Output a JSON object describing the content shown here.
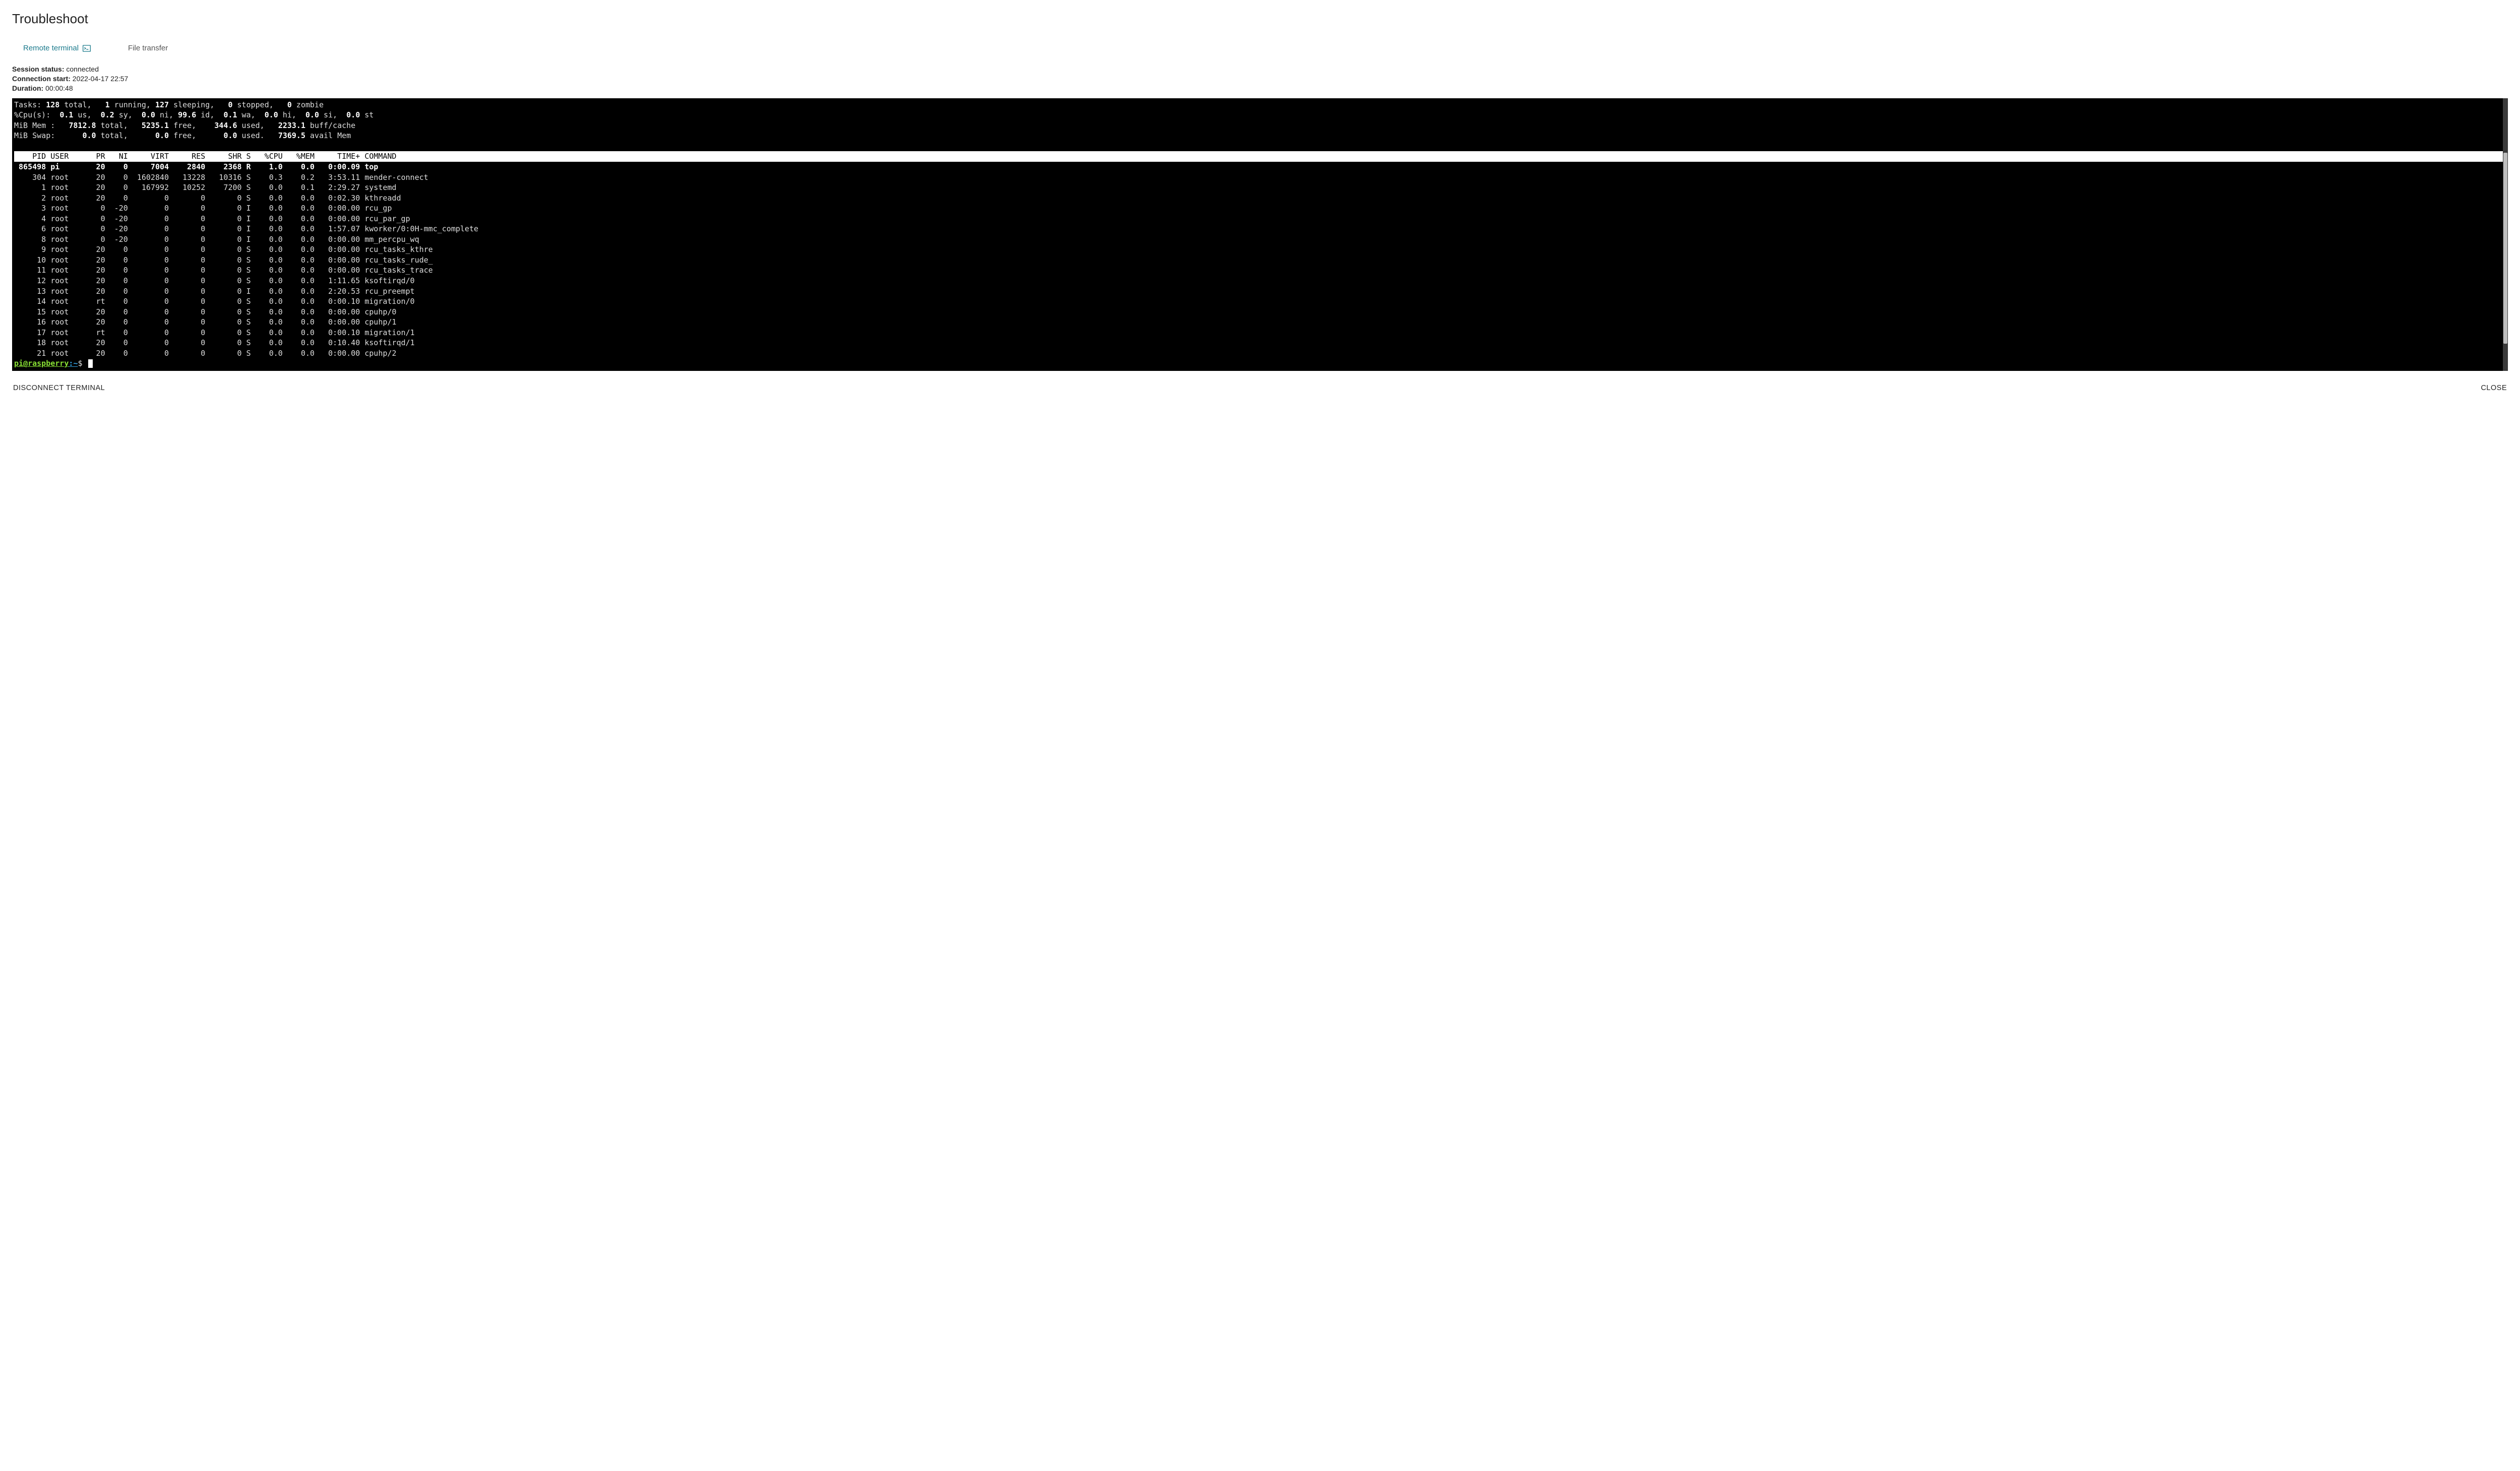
{
  "page": {
    "title": "Troubleshoot"
  },
  "tabs": {
    "remote_terminal": "Remote terminal",
    "file_transfer": "File transfer"
  },
  "status": {
    "session_label": "Session status:",
    "session_value": "connected",
    "conn_label": "Connection start:",
    "conn_value": "2022-04-17 22:57",
    "duration_label": "Duration:",
    "duration_value": "00:00:48"
  },
  "top": {
    "tasks": {
      "total": 128,
      "running": 1,
      "sleeping": 127,
      "stopped": 0,
      "zombie": 0
    },
    "cpu": {
      "us": 0.1,
      "sy": 0.2,
      "ni": 0.0,
      "id": 99.6,
      "wa": 0.1,
      "hi": 0.0,
      "si": 0.0,
      "st": 0.0
    },
    "mem": {
      "total": 7812.8,
      "free": 5235.1,
      "used": 344.6,
      "buff_cache": 2233.1
    },
    "swap": {
      "total": 0.0,
      "free": 0.0,
      "used": 0.0,
      "avail_mem": 7369.5
    },
    "columns": [
      "PID",
      "USER",
      "PR",
      "NI",
      "VIRT",
      "RES",
      "SHR",
      "S",
      "%CPU",
      "%MEM",
      "TIME+",
      "COMMAND"
    ],
    "processes": [
      {
        "pid": 865498,
        "user": "pi",
        "pr": "20",
        "ni": "0",
        "virt": 7004,
        "res": 2840,
        "shr": 2368,
        "s": "R",
        "cpu": 1.0,
        "mem": 0.0,
        "time": "0:00.09",
        "cmd": "top",
        "highlight": true
      },
      {
        "pid": 304,
        "user": "root",
        "pr": "20",
        "ni": "0",
        "virt": 1602840,
        "res": 13228,
        "shr": 10316,
        "s": "S",
        "cpu": 0.3,
        "mem": 0.2,
        "time": "3:53.11",
        "cmd": "mender-connect"
      },
      {
        "pid": 1,
        "user": "root",
        "pr": "20",
        "ni": "0",
        "virt": 167992,
        "res": 10252,
        "shr": 7200,
        "s": "S",
        "cpu": 0.0,
        "mem": 0.1,
        "time": "2:29.27",
        "cmd": "systemd"
      },
      {
        "pid": 2,
        "user": "root",
        "pr": "20",
        "ni": "0",
        "virt": 0,
        "res": 0,
        "shr": 0,
        "s": "S",
        "cpu": 0.0,
        "mem": 0.0,
        "time": "0:02.30",
        "cmd": "kthreadd"
      },
      {
        "pid": 3,
        "user": "root",
        "pr": "0",
        "ni": "-20",
        "virt": 0,
        "res": 0,
        "shr": 0,
        "s": "I",
        "cpu": 0.0,
        "mem": 0.0,
        "time": "0:00.00",
        "cmd": "rcu_gp"
      },
      {
        "pid": 4,
        "user": "root",
        "pr": "0",
        "ni": "-20",
        "virt": 0,
        "res": 0,
        "shr": 0,
        "s": "I",
        "cpu": 0.0,
        "mem": 0.0,
        "time": "0:00.00",
        "cmd": "rcu_par_gp"
      },
      {
        "pid": 6,
        "user": "root",
        "pr": "0",
        "ni": "-20",
        "virt": 0,
        "res": 0,
        "shr": 0,
        "s": "I",
        "cpu": 0.0,
        "mem": 0.0,
        "time": "1:57.07",
        "cmd": "kworker/0:0H-mmc_complete"
      },
      {
        "pid": 8,
        "user": "root",
        "pr": "0",
        "ni": "-20",
        "virt": 0,
        "res": 0,
        "shr": 0,
        "s": "I",
        "cpu": 0.0,
        "mem": 0.0,
        "time": "0:00.00",
        "cmd": "mm_percpu_wq"
      },
      {
        "pid": 9,
        "user": "root",
        "pr": "20",
        "ni": "0",
        "virt": 0,
        "res": 0,
        "shr": 0,
        "s": "S",
        "cpu": 0.0,
        "mem": 0.0,
        "time": "0:00.00",
        "cmd": "rcu_tasks_kthre"
      },
      {
        "pid": 10,
        "user": "root",
        "pr": "20",
        "ni": "0",
        "virt": 0,
        "res": 0,
        "shr": 0,
        "s": "S",
        "cpu": 0.0,
        "mem": 0.0,
        "time": "0:00.00",
        "cmd": "rcu_tasks_rude_"
      },
      {
        "pid": 11,
        "user": "root",
        "pr": "20",
        "ni": "0",
        "virt": 0,
        "res": 0,
        "shr": 0,
        "s": "S",
        "cpu": 0.0,
        "mem": 0.0,
        "time": "0:00.00",
        "cmd": "rcu_tasks_trace"
      },
      {
        "pid": 12,
        "user": "root",
        "pr": "20",
        "ni": "0",
        "virt": 0,
        "res": 0,
        "shr": 0,
        "s": "S",
        "cpu": 0.0,
        "mem": 0.0,
        "time": "1:11.65",
        "cmd": "ksoftirqd/0"
      },
      {
        "pid": 13,
        "user": "root",
        "pr": "20",
        "ni": "0",
        "virt": 0,
        "res": 0,
        "shr": 0,
        "s": "I",
        "cpu": 0.0,
        "mem": 0.0,
        "time": "2:20.53",
        "cmd": "rcu_preempt"
      },
      {
        "pid": 14,
        "user": "root",
        "pr": "rt",
        "ni": "0",
        "virt": 0,
        "res": 0,
        "shr": 0,
        "s": "S",
        "cpu": 0.0,
        "mem": 0.0,
        "time": "0:00.10",
        "cmd": "migration/0"
      },
      {
        "pid": 15,
        "user": "root",
        "pr": "20",
        "ni": "0",
        "virt": 0,
        "res": 0,
        "shr": 0,
        "s": "S",
        "cpu": 0.0,
        "mem": 0.0,
        "time": "0:00.00",
        "cmd": "cpuhp/0"
      },
      {
        "pid": 16,
        "user": "root",
        "pr": "20",
        "ni": "0",
        "virt": 0,
        "res": 0,
        "shr": 0,
        "s": "S",
        "cpu": 0.0,
        "mem": 0.0,
        "time": "0:00.00",
        "cmd": "cpuhp/1"
      },
      {
        "pid": 17,
        "user": "root",
        "pr": "rt",
        "ni": "0",
        "virt": 0,
        "res": 0,
        "shr": 0,
        "s": "S",
        "cpu": 0.0,
        "mem": 0.0,
        "time": "0:00.10",
        "cmd": "migration/1"
      },
      {
        "pid": 18,
        "user": "root",
        "pr": "20",
        "ni": "0",
        "virt": 0,
        "res": 0,
        "shr": 0,
        "s": "S",
        "cpu": 0.0,
        "mem": 0.0,
        "time": "0:10.40",
        "cmd": "ksoftirqd/1"
      },
      {
        "pid": 21,
        "user": "root",
        "pr": "20",
        "ni": "0",
        "virt": 0,
        "res": 0,
        "shr": 0,
        "s": "S",
        "cpu": 0.0,
        "mem": 0.0,
        "time": "0:00.00",
        "cmd": "cpuhp/2"
      }
    ],
    "prompt": {
      "user": "pi",
      "host": "raspberry",
      "path": "~",
      "symbol": "$"
    }
  },
  "buttons": {
    "disconnect": "DISCONNECT TERMINAL",
    "close": "CLOSE"
  }
}
